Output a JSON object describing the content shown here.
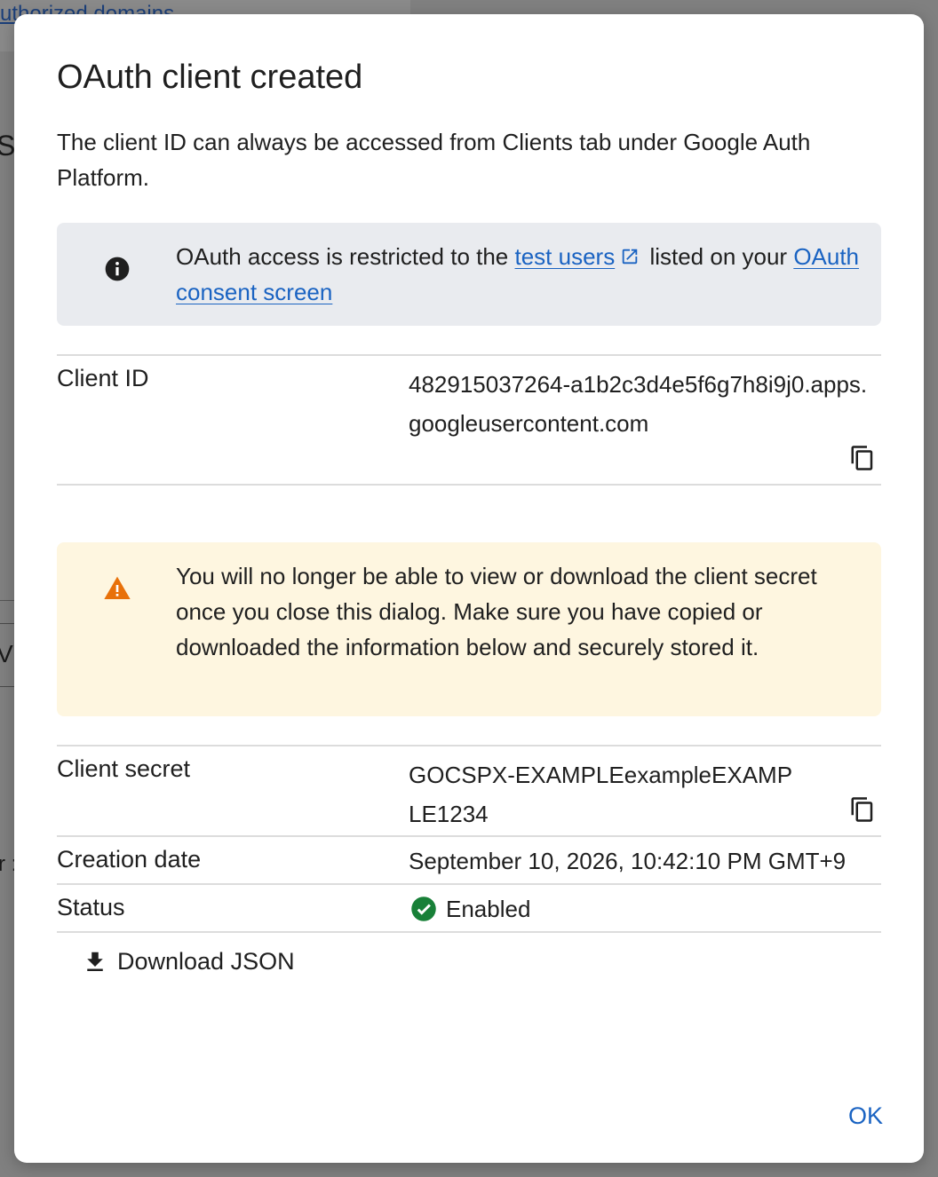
{
  "background": {
    "link_text": "uthorized domains",
    "letter_s": "S",
    "letter_v": "V",
    "letter_r": "r :"
  },
  "dialog": {
    "title": "OAuth client created",
    "subtitle": "The client ID can always be accessed from Clients tab under Google Auth Platform.",
    "info_banner": {
      "text_before": "OAuth access is restricted to the ",
      "link1": "test users",
      "text_middle": " listed on your ",
      "link2": "OAuth consent screen"
    },
    "client_id": {
      "label": "Client ID",
      "value": "482915037264-a1b2c3d4e5f6g7h8i9j0.apps.googleusercontent.com"
    },
    "warning_banner": {
      "text": "You will no longer be able to view or download the client secret once you close this dialog. Make sure you have copied or downloaded the information below and securely stored it."
    },
    "client_secret": {
      "label": "Client secret",
      "value": "GOCSPX-EXAMPLEexampleEXAMPLE1234"
    },
    "creation_date": {
      "label": "Creation date",
      "value": "September 10, 2026, 10:42:10 PM GMT+9"
    },
    "status": {
      "label": "Status",
      "value": "Enabled"
    },
    "download_label": "Download JSON",
    "ok_label": "OK"
  },
  "colors": {
    "accent": "#1a63c2",
    "info_bg": "#e9ebef",
    "warn_bg": "#fef6e0",
    "warn_icon": "#e8710a",
    "success": "#188038"
  }
}
